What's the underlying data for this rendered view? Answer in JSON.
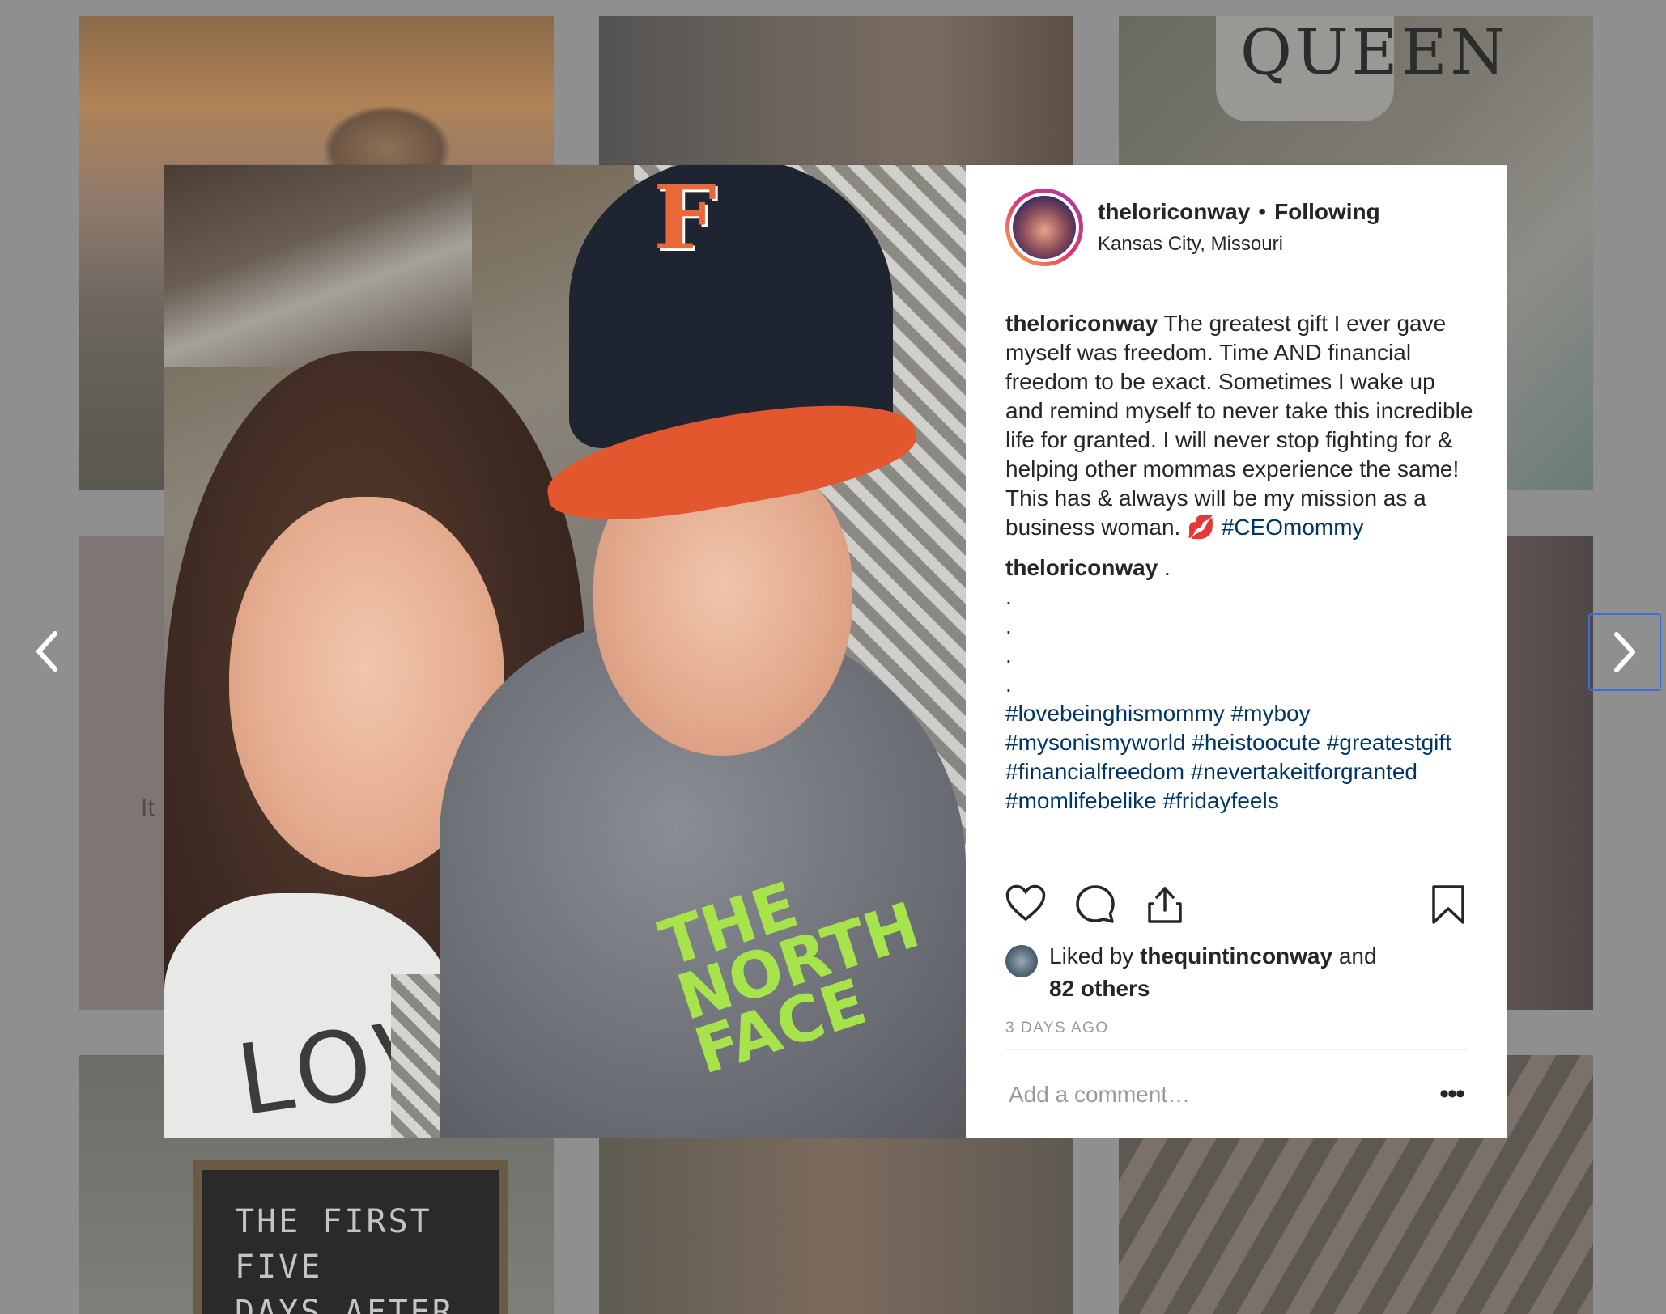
{
  "background_grid": {
    "mug_text": "QUEEN",
    "tile_text": "It",
    "letterboard_lines": [
      "THE FIRST FIVE",
      "DAYS AFTER"
    ]
  },
  "post": {
    "username": "theloriconway",
    "separator": "•",
    "follow_status": "Following",
    "location": "Kansas City, Missouri",
    "photo": {
      "cap_letter": "F",
      "shirt_text": "LOVE",
      "hoodie_logo_line1": "THE",
      "hoodie_logo_line2": "NORTH",
      "hoodie_logo_line3": "FACE"
    },
    "caption": {
      "username": "theloriconway",
      "text": "The greatest gift I ever gave myself was freedom. Time AND financial freedom to be exact. Sometimes I wake up and remind myself to never take this incredible life for granted. I will never stop fighting for & helping other mommas experience the same! This has & always will be my mission as a business woman. 💋",
      "hashtag": "#CEOmommy"
    },
    "comment": {
      "username": "theloriconway",
      "text": ".",
      "dots": [
        ".",
        ".",
        ".",
        "."
      ],
      "hashtags": [
        "#lovebeinghismommy",
        "#myboy",
        "#mysonismyworld",
        "#heistoocute",
        "#greatestgift",
        "#financialfreedom",
        "#nevertakeitforgranted",
        "#momlifebelike",
        "#fridayfeels"
      ]
    },
    "likes": {
      "prefix": "Liked by",
      "user": "thequintinconway",
      "and": "and",
      "others": "82 others"
    },
    "time_ago": "3 DAYS AGO",
    "comment_placeholder": "Add a comment…",
    "more_label": "•••"
  },
  "icons": {
    "prev": "chevron-left-icon",
    "next": "chevron-right-icon",
    "like": "heart-icon",
    "comment": "comment-bubble-icon",
    "share": "share-icon",
    "save": "bookmark-icon"
  },
  "colors": {
    "overlay": "#8f8f8f",
    "hashtag": "#003569",
    "text": "#262626",
    "muted": "#999999",
    "avatar_ring_start": "#f7b54a",
    "avatar_ring_end": "#a23bb3",
    "focus_outline": "#3b6fd6"
  }
}
